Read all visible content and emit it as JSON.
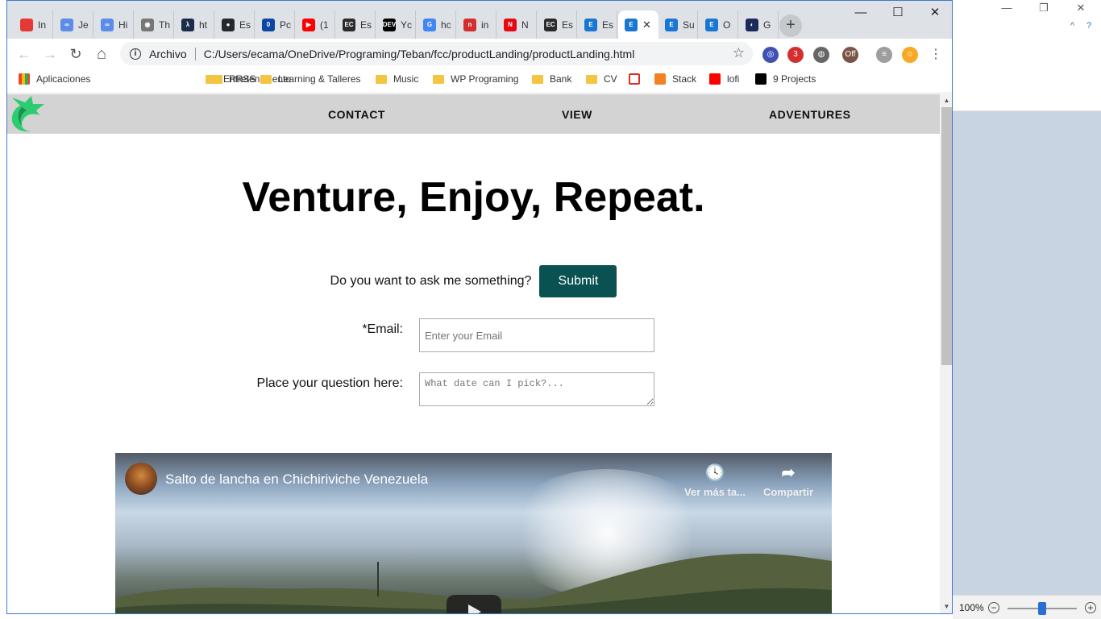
{
  "browser": {
    "tabs": [
      {
        "label": "In",
        "color": "#e53935",
        "glyph": ""
      },
      {
        "label": "Je",
        "color": "#5b8de8",
        "glyph": "∞"
      },
      {
        "label": "Hi",
        "color": "#5b8de8",
        "glyph": "∞"
      },
      {
        "label": "Th",
        "color": "#777777",
        "glyph": "◉"
      },
      {
        "label": "ht",
        "color": "#1b2b4a",
        "glyph": "λ"
      },
      {
        "label": "Es",
        "color": "#24292e",
        "glyph": "●"
      },
      {
        "label": "Pc",
        "color": "#0d47a1",
        "glyph": "0"
      },
      {
        "label": "(1",
        "color": "#ff0000",
        "glyph": "▶"
      },
      {
        "label": "Es",
        "color": "#2b2b2b",
        "glyph": "EC"
      },
      {
        "label": "Yc",
        "color": "#000000",
        "glyph": "DEV"
      },
      {
        "label": "hc",
        "color": "#4285f4",
        "glyph": "G"
      },
      {
        "label": "in",
        "color": "#d32f2f",
        "glyph": "n"
      },
      {
        "label": "N",
        "color": "#e50914",
        "glyph": "N"
      },
      {
        "label": "Es",
        "color": "#2b2b2b",
        "glyph": "EC"
      },
      {
        "label": "Es",
        "color": "#1976d2",
        "glyph": "E"
      },
      {
        "label": "",
        "color": "#1976d2",
        "glyph": "E",
        "active": true
      },
      {
        "label": "Su",
        "color": "#1976d2",
        "glyph": "E"
      },
      {
        "label": "O",
        "color": "#1976d2",
        "glyph": "E"
      },
      {
        "label": "G",
        "color": "#1a2b5a",
        "glyph": "◐"
      }
    ],
    "close_tab_glyph": "✕",
    "new_tab_glyph": "+",
    "window_controls": {
      "minimize": "—",
      "maximize": "☐",
      "close": "✕"
    },
    "nav": {
      "back": "←",
      "forward": "→",
      "reload": "↻",
      "home": "⌂"
    },
    "address": {
      "info_glyph": "i",
      "scheme_label": "Archivo",
      "url": "C:/Users/ecama/OneDrive/Programing/Teban/fcc/productLanding/productLanding.html",
      "star_glyph": "☆"
    },
    "extensions": [
      {
        "name": "extension-1",
        "color": "#3f51b5",
        "glyph": "◎"
      },
      {
        "name": "extension-2",
        "color": "#d32f2f",
        "glyph": "3"
      },
      {
        "name": "extension-3",
        "color": "#666666",
        "glyph": "◍"
      },
      {
        "name": "extension-4",
        "color": "#795548",
        "glyph": "Off"
      },
      {
        "name": "extension-5",
        "color": "#9e9e9e",
        "glyph": "≡"
      },
      {
        "name": "extension-6",
        "color": "#f9a825",
        "glyph": "☺"
      },
      {
        "name": "menu",
        "color": "#ffffff",
        "glyph": "⋮"
      }
    ],
    "bookmarks": [
      {
        "label": "Aplicaciones",
        "type": "apps"
      },
      {
        "label": "Entretenimiento",
        "type": "folder"
      },
      {
        "label": "RRSS",
        "type": "folder"
      },
      {
        "label": "Learning & Talleres",
        "type": "folder"
      },
      {
        "label": "Music",
        "type": "folder"
      },
      {
        "label": "WP Programing",
        "type": "folder"
      },
      {
        "label": "Bank",
        "type": "folder"
      },
      {
        "label": "CV",
        "type": "folder"
      },
      {
        "label": "",
        "type": "gmail"
      },
      {
        "label": "Stack",
        "type": "stack"
      },
      {
        "label": "lofi",
        "type": "youtube"
      },
      {
        "label": "9 Projects",
        "type": "medium"
      }
    ]
  },
  "page": {
    "nav_links": [
      "CONTACT",
      "VIEW",
      "ADVENTURES"
    ],
    "hero_title": "Venture, Enjoy, Repeat.",
    "ask_text": "Do you want to ask me something?",
    "submit_label": "Submit",
    "email_label": "*Email:",
    "email_placeholder": "Enter your Email",
    "question_label": "Place your question here:",
    "question_placeholder": "What date can I pick?...",
    "video": {
      "title": "Salto de lancha en Chichiriviche Venezuela",
      "watch_later_label": "Ver más ta...",
      "share_label": "Compartir",
      "watch_later_glyph": "🕓",
      "share_glyph": "➦"
    }
  },
  "background_window": {
    "controls": {
      "minimize": "—",
      "restore": "❐",
      "close": "✕"
    },
    "zoom_label": "100%",
    "zoom_minus": "−",
    "zoom_plus": "+"
  }
}
